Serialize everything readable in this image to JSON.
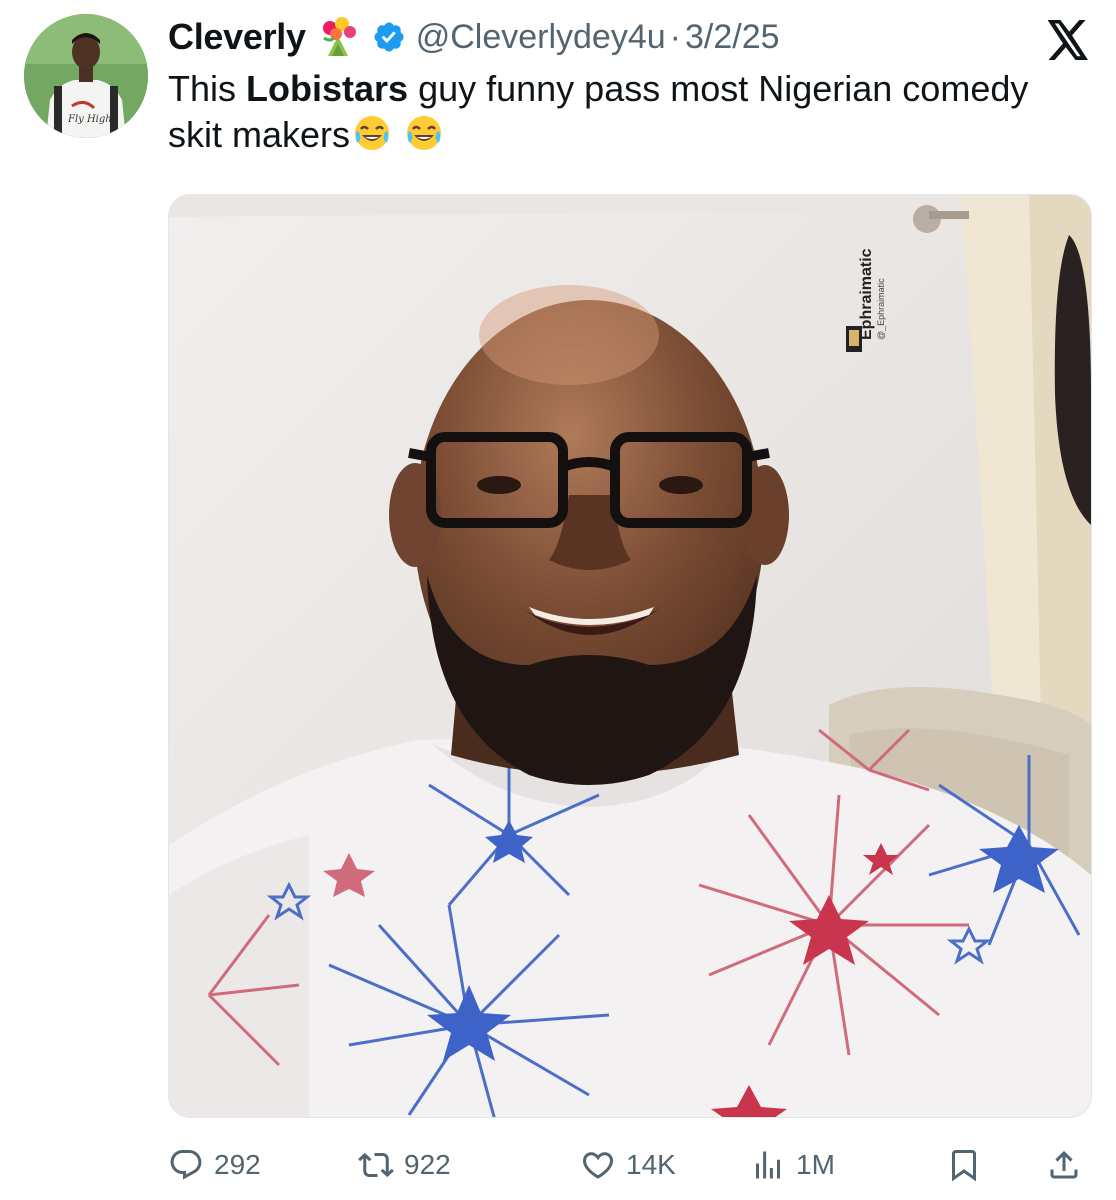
{
  "tweet": {
    "display_name": "Cleverly",
    "name_emoji": "bouquet-emoji",
    "verified": true,
    "handle": "@Cleverlydey4u",
    "separator": "·",
    "date": "3/2/25",
    "text_prefix": "This ",
    "text_bold": "Lobistars",
    "text_suffix": " guy funny pass most Nigerian comedy skit makers",
    "trailing_emojis": [
      "face-with-tears-of-joy-emoji",
      "face-with-tears-of-joy-emoji"
    ],
    "watermark_main": "Ephraimatic",
    "watermark_sub": "@_Ephraimatic",
    "avatar_shirt_text": "Fly High"
  },
  "actions": {
    "replies": "292",
    "retweets": "922",
    "likes": "14K",
    "views": "1M"
  },
  "colors": {
    "text": "#0f1419",
    "secondary": "#536471",
    "verified": "#1d9bf0"
  }
}
